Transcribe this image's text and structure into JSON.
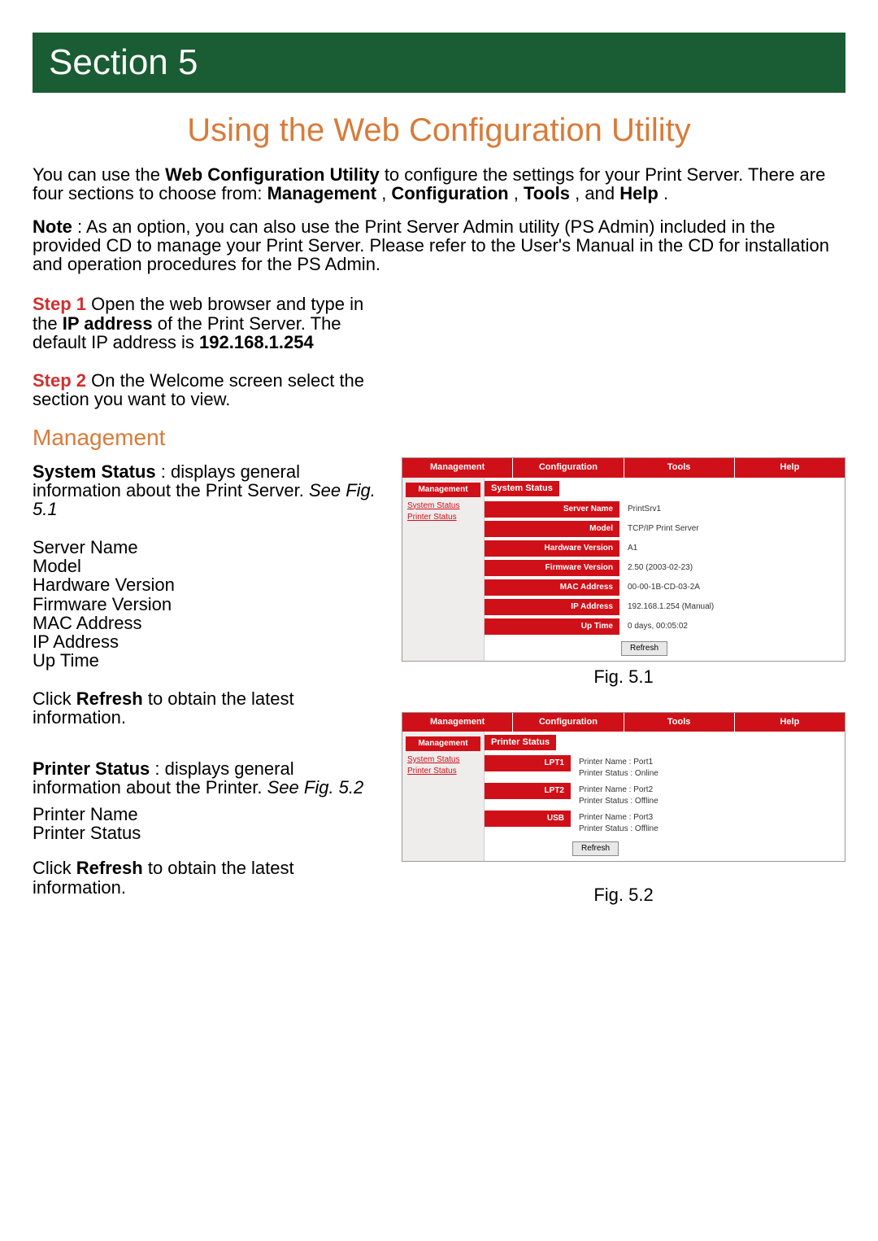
{
  "banner": "Section 5",
  "title": "Using the Web Configuration Utility",
  "intro": {
    "p1_a": "You can use the ",
    "p1_b": "Web Configuration Utility",
    "p1_c": " to configure the settings for your Print Server. There are four sections to choose from: ",
    "p1_d": "Management",
    "p1_e": ", ",
    "p1_f": "Configuration",
    "p1_g": ", ",
    "p1_h": "Tools",
    "p1_i": ", and ",
    "p1_j": "Help",
    "p1_k": ".",
    "p2_a": "Note",
    "p2_b": ": As an option, you can also use the Print Server Admin utility (PS Admin) included in the provided CD to manage your Print Server.  Please refer to the User's Manual in the CD for installation and operation procedures for the PS Admin."
  },
  "steps": {
    "s1_label": "Step 1",
    "s1_a": " Open the web browser and type in the ",
    "s1_b": "IP address",
    "s1_c": " of the Print Server. The default IP address is ",
    "s1_d": "192.168.1.254",
    "s2_label": "Step 2",
    "s2_a": " On the Welcome screen select the section you want to view."
  },
  "mgmt_heading": "Management",
  "sys_status": {
    "lead_b": "System Status",
    "lead_a": ": displays general information about the Print Server. ",
    "lead_i": "See Fig. 5.1",
    "fields": "Server Name\nModel\nHardware Version\nFirmware Version\nMAC Address\nIP Address\nUp Time",
    "refresh_a": "Click ",
    "refresh_b": "Refresh",
    "refresh_c": " to obtain the latest information."
  },
  "printer_status": {
    "lead_b": "Printer Status",
    "lead_a": ": displays general information about the Printer. ",
    "lead_i": "See Fig. 5.2",
    "fields": "Printer Name\nPrinter Status",
    "refresh_a": "Click ",
    "refresh_b": "Refresh",
    "refresh_c": " to obtain the latest information."
  },
  "fig1": {
    "caption": "Fig. 5.1",
    "tabs": {
      "t0": "Management",
      "t1": "Configuration",
      "t2": "Tools",
      "t3": "Help"
    },
    "side_head": "Management",
    "side_link1": "System Status",
    "side_link2": "Printer Status",
    "panel_head": "System Status",
    "rows": {
      "k0": "Server Name",
      "v0": "PrintSrv1",
      "k1": "Model",
      "v1": "TCP/IP Print Server",
      "k2": "Hardware Version",
      "v2": "A1",
      "k3": "Firmware Version",
      "v3": "2.50 (2003-02-23)",
      "k4": "MAC Address",
      "v4": "00-00-1B-CD-03-2A",
      "k5": "IP Address",
      "v5": "192.168.1.254 (Manual)",
      "k6": "Up Time",
      "v6": "0 days, 00:05:02"
    },
    "refresh": "Refresh"
  },
  "fig2": {
    "caption": "Fig. 5.2",
    "tabs": {
      "t0": "Management",
      "t1": "Configuration",
      "t2": "Tools",
      "t3": "Help"
    },
    "side_head": "Management",
    "side_link1": "System Status",
    "side_link2": "Printer Status",
    "panel_head": "Printer Status",
    "ports": {
      "p1_key": "LPT1",
      "p1_l1": "Printer Name :  Port1",
      "p1_l2": "Printer Status :  Online",
      "p2_key": "LPT2",
      "p2_l1": "Printer Name :  Port2",
      "p2_l2": "Printer Status :  Offline",
      "p3_key": "USB",
      "p3_l1": "Printer Name :  Port3",
      "p3_l2": "Printer Status :  Offline"
    },
    "refresh": "Refresh"
  }
}
